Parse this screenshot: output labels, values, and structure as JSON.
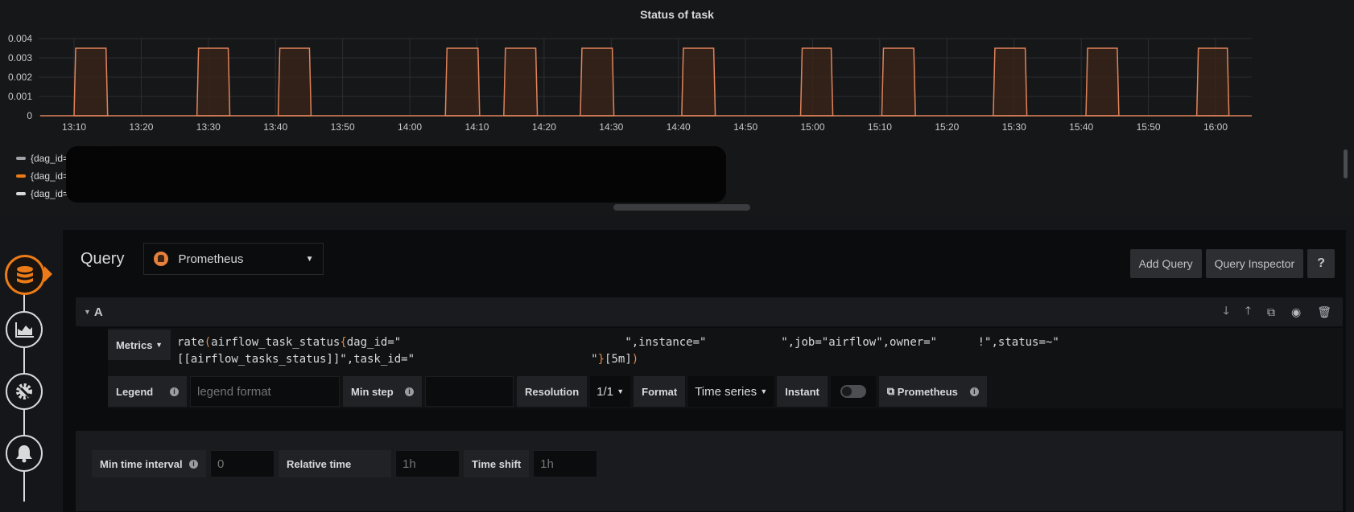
{
  "graph": {
    "title": "Status of task",
    "legend": [
      {
        "label": "{dag_id='",
        "color": "#9fa3a8"
      },
      {
        "label": "{dag_id='",
        "color": "#eb7b18"
      },
      {
        "label": "{dag_id='",
        "color": "#d8d9da"
      }
    ]
  },
  "chart_data": {
    "type": "area",
    "title": "Status of task",
    "xlabel": "",
    "ylabel": "",
    "x_ticks": [
      "13:10",
      "13:20",
      "13:30",
      "13:40",
      "13:50",
      "14:00",
      "14:10",
      "14:20",
      "14:30",
      "14:40",
      "14:50",
      "15:00",
      "15:10",
      "15:20",
      "15:30",
      "15:40",
      "15:50",
      "16:00"
    ],
    "y_ticks": [
      "0",
      "0.001",
      "0.002",
      "0.003",
      "0.004"
    ],
    "ylim": [
      0,
      0.004
    ],
    "xlim_minutes_from_1300": [
      5,
      65
    ],
    "grid": true,
    "series": [
      {
        "name": "{dag_id='...'}",
        "color": "#e0835a",
        "pulse_value": 0.0035,
        "pulses_minutes_from_1300": [
          [
            10.0,
            15.0
          ],
          [
            28.3,
            33.2
          ],
          [
            40.4,
            45.3
          ],
          [
            65.3,
            70.4
          ],
          [
            74.0,
            79.0
          ],
          [
            85.4,
            90.4
          ],
          [
            100.5,
            105.5
          ],
          [
            118.2,
            123.0
          ],
          [
            130.3,
            135.3
          ],
          [
            146.9,
            151.9
          ],
          [
            160.7,
            165.6
          ],
          [
            177.2,
            182.0
          ]
        ]
      }
    ]
  },
  "query": {
    "title": "Query",
    "datasource": "Prometheus",
    "add_query": "Add Query",
    "query_inspector": "Query Inspector",
    "help": "?",
    "row_label": "A",
    "metrics_label": "Metrics",
    "expr_line1_pre": "rate",
    "expr_line1_a": "airflow_task_status",
    "expr_line1_b": "dag_id=\"                                 \",instance=\"           \",job=\"airflow\",owner=\"      !\",status=~\"",
    "expr_line2_a": "[[airflow_tasks_status]]\",task_id=\"                          \"",
    "expr_line2_b": "[5m]",
    "legend_label": "Legend",
    "legend_placeholder": "legend format",
    "min_step_label": "Min step",
    "min_step_value": "",
    "resolution_label": "Resolution",
    "resolution_value": "1/1",
    "format_label": "Format",
    "format_value": "Time series",
    "instant_label": "Instant",
    "instant_on": false,
    "prom_link": "Prometheus",
    "min_time_interval_label": "Min time interval",
    "min_time_interval_placeholder": "0",
    "relative_time_label": "Relative time",
    "relative_time_placeholder": "1h",
    "time_shift_label": "Time shift",
    "time_shift_placeholder": "1h"
  },
  "side_nav": [
    "queries",
    "visualization",
    "general",
    "alert"
  ]
}
